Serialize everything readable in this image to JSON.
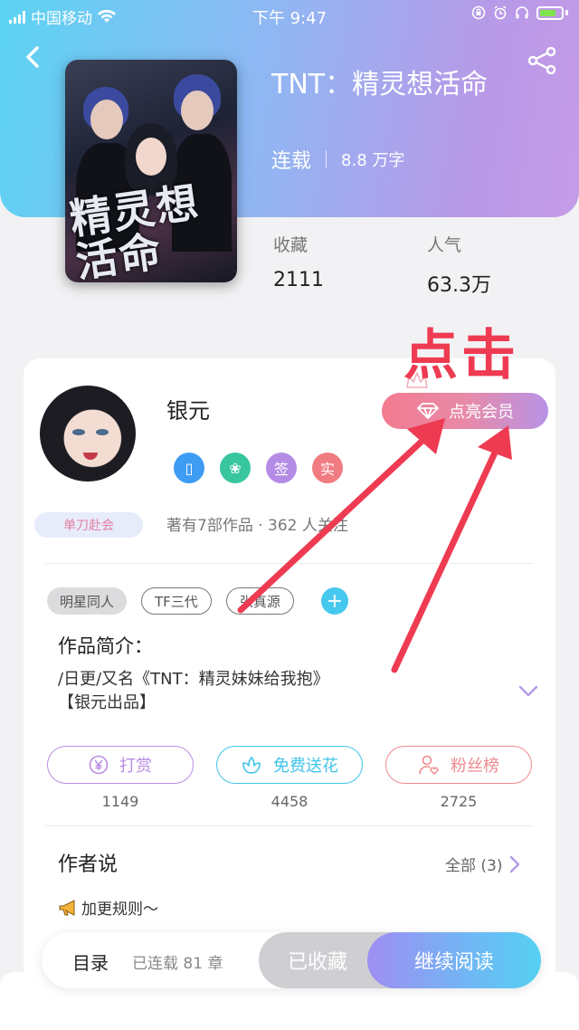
{
  "status_bar": {
    "carrier": "中国移动",
    "time": "下午 9:47"
  },
  "book": {
    "title": "TNT：精灵想活命",
    "status": "连载",
    "word_count": "8.8 万字",
    "cover_text": "精灵想活命",
    "stats": [
      {
        "label": "收藏",
        "value": "2111"
      },
      {
        "label": "人气",
        "value": "63.3万"
      }
    ]
  },
  "author": {
    "name": "银元",
    "vip_button": "点亮会员",
    "badges": [
      {
        "name": "phone-badge-icon",
        "glyph": "▯",
        "color": "#3f9cf3"
      },
      {
        "name": "handshake-badge-icon",
        "glyph": "❀",
        "color": "#37c6a0"
      },
      {
        "name": "sign-badge",
        "glyph": "签",
        "color": "#b48ce6"
      },
      {
        "name": "verified-badge",
        "glyph": "实",
        "color": "#f07c82"
      }
    ],
    "group_tag": "单刀赴会",
    "works_info": "著有7部作品 · 362 人关注"
  },
  "tags": [
    "明星同人",
    "TF三代",
    "张真源"
  ],
  "intro": {
    "label": "作品简介：",
    "text": "/日更/又名《TNT：精灵妹妹给我抱》\n【银元出品】"
  },
  "actions": [
    {
      "id": "reward",
      "label": "打赏",
      "count": "1149",
      "color": "#b98ce4",
      "icon": "¥"
    },
    {
      "id": "flower",
      "label": "免费送花",
      "count": "4458",
      "color": "#3fc4e8",
      "icon": "✿"
    },
    {
      "id": "fans",
      "label": "粉丝榜",
      "count": "2725",
      "color": "#ee8a8f",
      "icon": "♥"
    }
  ],
  "author_says": {
    "label": "作者说",
    "all": "全部 (3)",
    "item": "加更规则～"
  },
  "bottom_bar": {
    "toc": "目录",
    "chapters": "已连载 81 章",
    "favorited": "已收藏",
    "continue": "继续阅读"
  },
  "annotation": {
    "text": "点击"
  }
}
